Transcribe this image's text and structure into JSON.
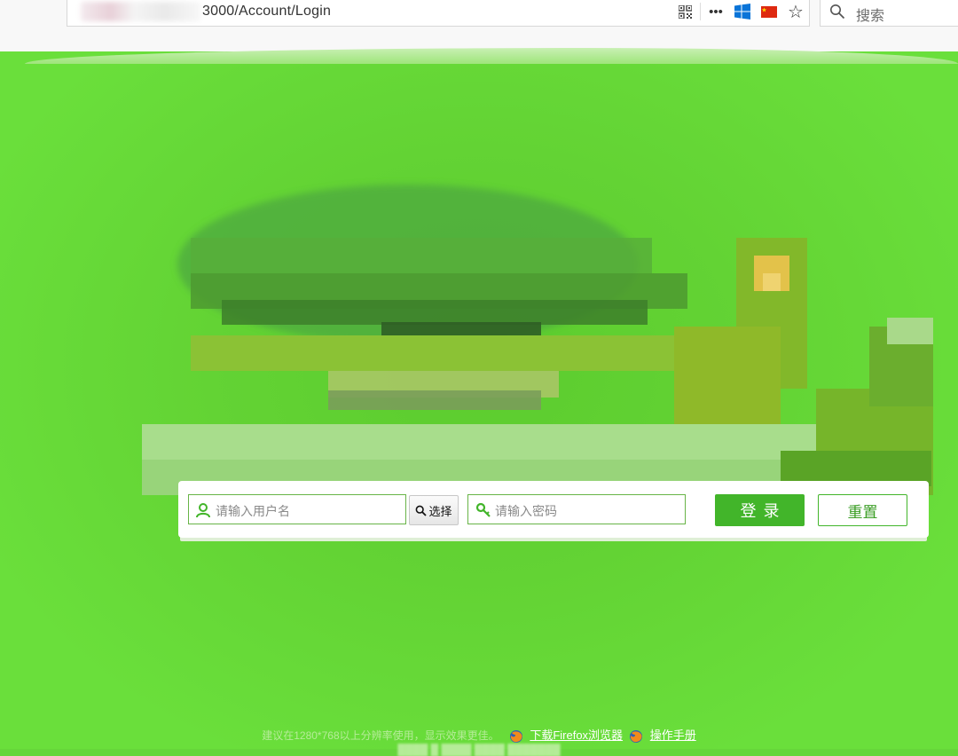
{
  "browser": {
    "url_visible": "3000/Account/Login",
    "search_placeholder": "搜索",
    "icons": [
      "qr-code-icon",
      "more-icon",
      "windows-icon",
      "china-flag-icon",
      "bookmark-star-icon",
      "search-icon"
    ],
    "more_label": "•••",
    "star_label": "☆"
  },
  "login": {
    "username_placeholder": "请输入用户名",
    "choose_label": "选择",
    "password_placeholder": "请输入密码",
    "login_label": "登录",
    "reset_label": "重置"
  },
  "footer": {
    "tip": "建议在1280*768以上分辨率使用，显示效果更佳。",
    "firefox_link": "下载Firefox浏览器",
    "manual_link": "操作手册"
  },
  "colors": {
    "page_bg": "#66d63a",
    "accent": "#42b52a"
  }
}
